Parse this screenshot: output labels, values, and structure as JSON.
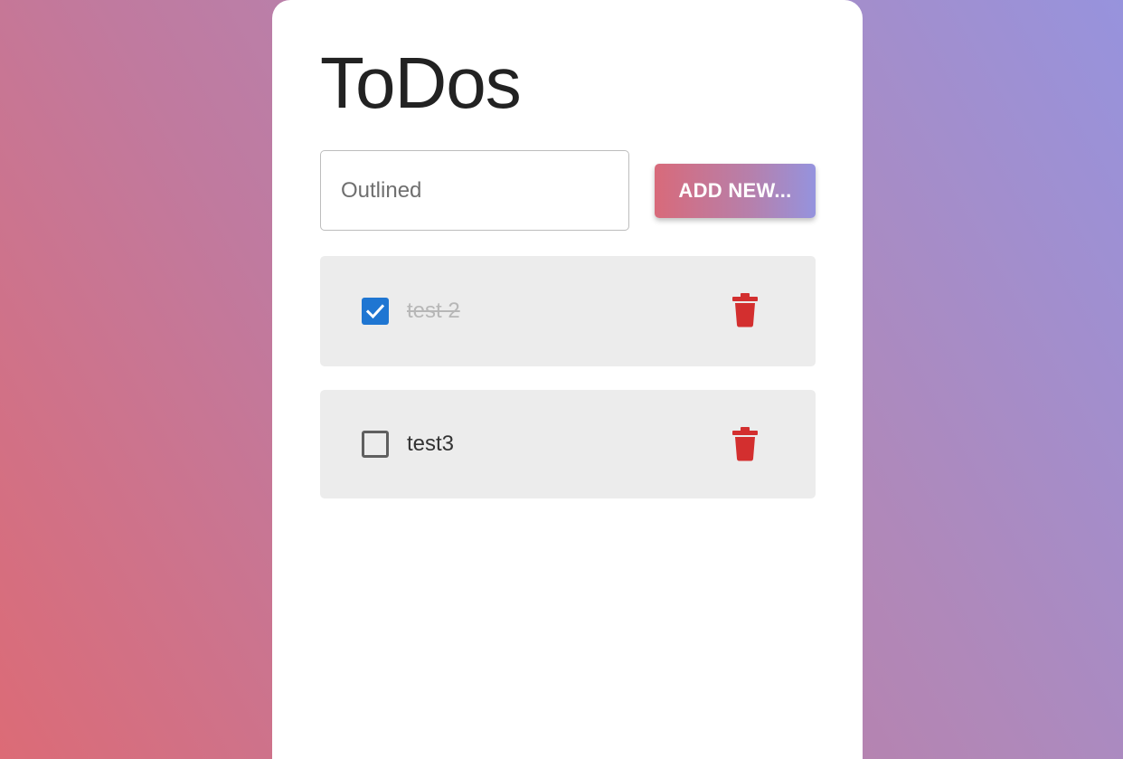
{
  "app": {
    "title": "ToDos"
  },
  "new_todo": {
    "placeholder": "Outlined",
    "value": "",
    "add_button_label": "ADD NEW..."
  },
  "todos": [
    {
      "label": "test 2",
      "completed": true
    },
    {
      "label": "test3",
      "completed": false
    }
  ],
  "colors": {
    "checkbox_checked": "#1f76d2",
    "delete_icon": "#d32f2f",
    "item_background": "#ececec",
    "completed_text": "#b7b7b7"
  },
  "icons": {
    "checked": "check-icon",
    "delete": "trash-icon"
  }
}
